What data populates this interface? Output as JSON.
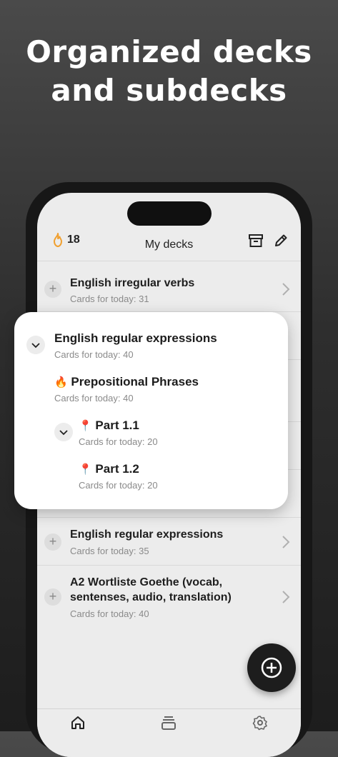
{
  "headline": {
    "line1": "Organized decks",
    "line2": "and subdecks"
  },
  "header": {
    "streak_count": "18",
    "title": "My decks"
  },
  "decks": [
    {
      "name": "English irregular verbs",
      "sub": "Cards for today: 31"
    },
    {
      "name": "English regular expressions",
      "sub": "Cards for today: 35"
    },
    {
      "name": "A2 Wortliste Goethe (vocab, sentenses, audio, translation)",
      "sub": "Cards for today: 40"
    }
  ],
  "popup": {
    "root": {
      "name": "English regular expressions",
      "sub": "Cards for today: 40"
    },
    "child": {
      "icon": "🔥",
      "name": "Prepositional Phrases",
      "sub": "Cards for today: 40"
    },
    "part1": {
      "icon": "📍",
      "name": "Part 1.1",
      "sub": "Cards for today: 20"
    },
    "part2": {
      "icon": "📍",
      "name": "Part 1.2",
      "sub": "Cards for today: 20"
    }
  },
  "icons": {
    "streak": "flame-icon",
    "archive": "archive-icon",
    "edit": "pencil-icon",
    "fab": "plus-circle-icon",
    "tab_home": "home-icon",
    "tab_cards": "cards-stack-icon",
    "tab_settings": "gear-icon"
  },
  "colors": {
    "flame": "#f0a030",
    "fab": "#1d1d1d"
  }
}
